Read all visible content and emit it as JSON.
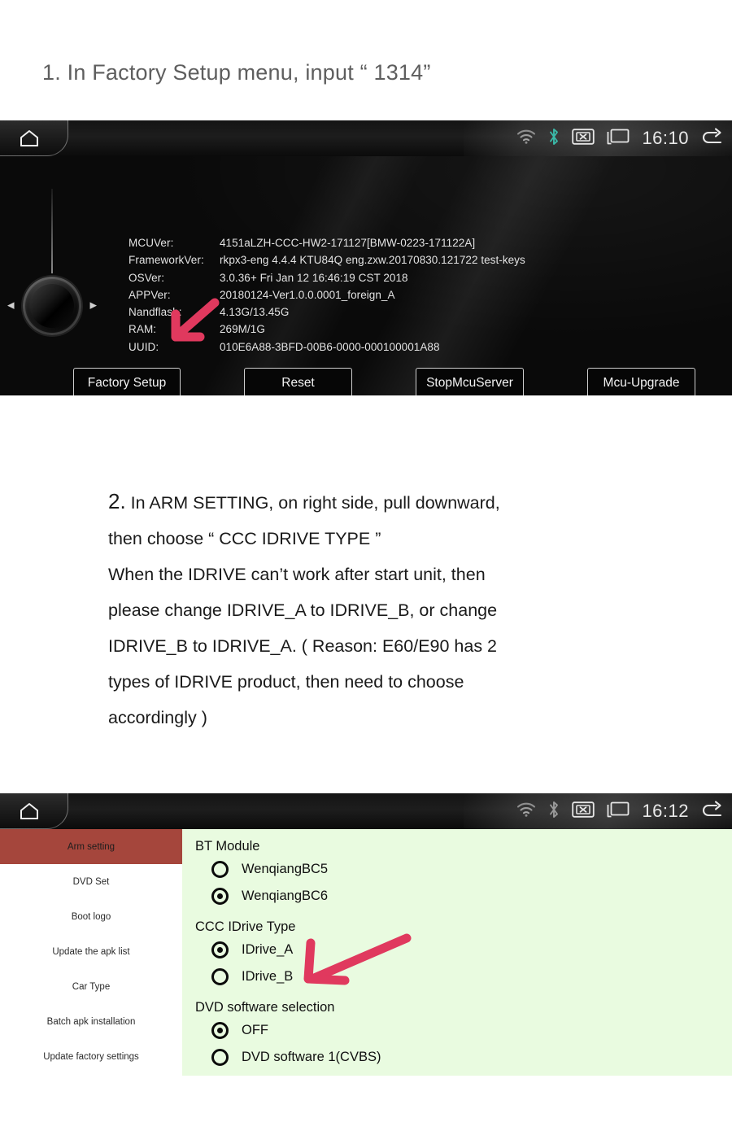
{
  "steps": {
    "step1_heading": "1. In Factory Setup menu, input “ 1314”",
    "step2_number": "2.",
    "step2_lines": [
      " In ARM SETTING, on right side, pull downward,",
      "then choose “ CCC IDRIVE TYPE ”",
      "When the IDRIVE can’t work after start unit, then",
      "please change IDRIVE_A to IDRIVE_B, or change",
      "IDRIVE_B to IDRIVE_A. ( Reason: E60/E90 has 2",
      "types of IDRIVE product, then need to choose",
      "accordingly )"
    ]
  },
  "device1": {
    "statusbar": {
      "home_icon": "home-icon",
      "wifi_icon": "wifi-icon",
      "bluetooth_icon": "bluetooth-icon",
      "mute_icon": "mute-x-icon",
      "screen_icon": "display-icon",
      "clock": "16:10",
      "back_icon": "back-arrow-icon",
      "bluetooth_color": "#3ab9a8"
    },
    "knob": {
      "left_chevron": "◂",
      "right_chevron": "▸"
    },
    "info": [
      {
        "key": "MCUVer:",
        "value": "4151aLZH-CCC-HW2-171127[BMW-0223-171122A]"
      },
      {
        "key": "FrameworkVer:",
        "value": "rkpx3-eng 4.4.4 KTU84Q eng.zxw.20170830.121722 test-keys"
      },
      {
        "key": "OSVer:",
        "value": "3.0.36+  Fri Jan 12 16:46:19 CST 2018"
      },
      {
        "key": "APPVer:",
        "value": "20180124-Ver1.0.0.0001_foreign_A"
      },
      {
        "key": "Nandflash:",
        "value": "4.13G/13.45G"
      },
      {
        "key": "RAM:",
        "value": "269M/1G"
      },
      {
        "key": "UUID:",
        "value": "010E6A88-3BFD-00B6-0000-000100001A88"
      }
    ],
    "buttons": [
      {
        "label": "Factory Setup"
      },
      {
        "label": "Reset"
      },
      {
        "label": "StopMcuServer"
      },
      {
        "label": "Mcu-Upgrade"
      }
    ]
  },
  "device2": {
    "statusbar": {
      "home_icon": "home-icon",
      "wifi_icon": "wifi-icon",
      "bluetooth_icon": "bluetooth-icon",
      "mute_icon": "mute-x-icon",
      "screen_icon": "display-icon",
      "clock": "16:12",
      "back_icon": "back-arrow-icon",
      "bluetooth_color": "#9a9a9a"
    },
    "sidebar": [
      {
        "label": "Arm setting",
        "active": true
      },
      {
        "label": "DVD Set",
        "active": false
      },
      {
        "label": "Boot logo",
        "active": false
      },
      {
        "label": "Update the apk list",
        "active": false
      },
      {
        "label": "Car Type",
        "active": false
      },
      {
        "label": "Batch apk installation",
        "active": false
      },
      {
        "label": "Update factory settings",
        "active": false
      }
    ],
    "groups": [
      {
        "title": "BT Module",
        "options": [
          {
            "label": "WenqiangBC5",
            "selected": false
          },
          {
            "label": "WenqiangBC6",
            "selected": true
          }
        ]
      },
      {
        "title": "CCC IDrive Type",
        "options": [
          {
            "label": "IDrive_A",
            "selected": true
          },
          {
            "label": "IDrive_B",
            "selected": false
          }
        ]
      },
      {
        "title": "DVD software selection",
        "options": [
          {
            "label": "OFF",
            "selected": true
          },
          {
            "label": "DVD software 1(CVBS)",
            "selected": false
          }
        ]
      }
    ],
    "panel_bg": "#e9fbe0",
    "active_item_bg": "#a5463c"
  },
  "annotations": {
    "arrow_color": "#e0395e",
    "arrow1_target": "Factory Setup",
    "arrow2_target": "IDrive_A"
  }
}
